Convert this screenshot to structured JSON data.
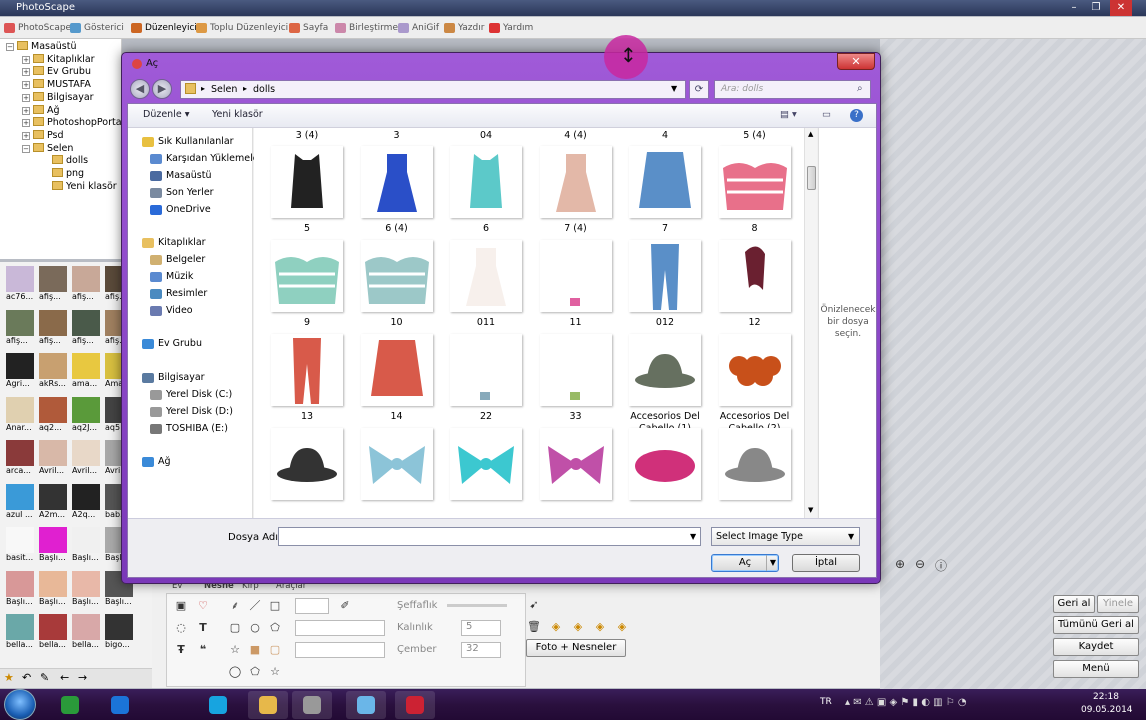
{
  "app": {
    "title": "PhotoScape",
    "tabs": [
      {
        "label": "PhotoScape",
        "color": "#d55"
      },
      {
        "label": "Gösterici",
        "color": "#59c"
      },
      {
        "label": "Düzenleyici",
        "color": "#c62"
      },
      {
        "label": "Toplu Düzenleyici",
        "color": "#d94"
      },
      {
        "label": "Sayfa",
        "color": "#d64"
      },
      {
        "label": "Birleştirme",
        "color": "#c8a"
      },
      {
        "label": "AniGif",
        "color": "#a9c"
      },
      {
        "label": "Yazdır",
        "color": "#c84"
      },
      {
        "label": "Yardım",
        "color": "#d33"
      }
    ],
    "window_controls": [
      "–",
      "❐",
      "✕"
    ],
    "folder_tree": [
      {
        "label": "Masaüstü",
        "level": 0,
        "expander": "−"
      },
      {
        "label": "Kitaplıklar",
        "level": 1,
        "expander": "+"
      },
      {
        "label": "Ev Grubu",
        "level": 1,
        "expander": "+"
      },
      {
        "label": "MUSTAFA",
        "level": 1,
        "expander": "+"
      },
      {
        "label": "Bilgisayar",
        "level": 1,
        "expander": "+"
      },
      {
        "label": "Ağ",
        "level": 1,
        "expander": "+"
      },
      {
        "label": "PhotoshopPorta",
        "level": 1,
        "expander": "+"
      },
      {
        "label": "Psd",
        "level": 1,
        "expander": "+"
      },
      {
        "label": "Selen",
        "level": 1,
        "expander": "−"
      },
      {
        "label": "dolls",
        "level": 2,
        "expander": ""
      },
      {
        "label": "png",
        "level": 2,
        "expander": ""
      },
      {
        "label": "Yeni klasör",
        "level": 2,
        "expander": ""
      }
    ],
    "thumbnails": [
      "ac76...",
      "afiş...",
      "afiş...",
      "afiş...",
      "afiş...",
      "afiş...",
      "afiş...",
      "afiş...",
      "Agri...",
      "akRs...",
      "ama...",
      "Ama...",
      "Anar...",
      "aq2...",
      "aq2J...",
      "aq5...",
      "arca...",
      "Avril...",
      "Avril...",
      "Avril...",
      "azul ...",
      "A2m...",
      "A2q...",
      "bab...",
      "basit...",
      "Başlı...",
      "Başlı...",
      "Başlı...",
      "Başlı...",
      "Başlı...",
      "Başlı...",
      "Başlı...",
      "bella...",
      "bella...",
      "bella...",
      "bigo..."
    ],
    "editor_tabs": [
      "Ev",
      "Nesne",
      "Kırp",
      "Araçlar"
    ],
    "editor_labels": {
      "transparency": "Şeffaflık",
      "thickness": "Kalınlık",
      "border": "Çember",
      "thickness_value": "5",
      "border_value": "32"
    },
    "photo_objects_button": "Foto + Nesneler",
    "right_buttons": {
      "undo": "Geri al",
      "redo": "Yinele",
      "undo_all": "Tümünü Geri al",
      "save": "Kaydet",
      "menu": "Menü"
    }
  },
  "dialog": {
    "title": "Aç",
    "close": "✕",
    "breadcrumb": [
      "Selen",
      "dolls"
    ],
    "search_placeholder": "Ara: dolls",
    "cmd_organize": "Düzenle",
    "cmd_new_folder": "Yeni klasör",
    "nav": {
      "favorites_header": "Sık Kullanılanlar",
      "favorites": [
        "Karşıdan Yüklemeler",
        "Masaüstü",
        "Son Yerler",
        "OneDrive"
      ],
      "libraries_header": "Kitaplıklar",
      "libraries": [
        "Belgeler",
        "Müzik",
        "Resimler",
        "Video"
      ],
      "homegroup": "Ev Grubu",
      "computer_header": "Bilgisayar",
      "drives": [
        "Yerel Disk (C:)",
        "Yerel Disk (D:)",
        "TOSHIBA (E:)"
      ],
      "network": "Ağ"
    },
    "top_labels": [
      "3 (4)",
      "3",
      "04",
      "4 (4)",
      "4",
      "5 (4)"
    ],
    "files": [
      {
        "name": "5",
        "color": "#222",
        "shape": "vest"
      },
      {
        "name": "6 (4)",
        "color": "#2a4fc8",
        "shape": "dress"
      },
      {
        "name": "6",
        "color": "#5cc9c9",
        "shape": "vest"
      },
      {
        "name": "7 (4)",
        "color": "#e3b8a8",
        "shape": "dress"
      },
      {
        "name": "7",
        "color": "#5a8fc8",
        "shape": "skirt"
      },
      {
        "name": "8",
        "color": "#e8708a",
        "shape": "top"
      },
      {
        "name": "9",
        "color": "#8fd0c0",
        "shape": "top"
      },
      {
        "name": "10",
        "color": "#9cc8c8",
        "shape": "top"
      },
      {
        "name": "011",
        "color": "#f7f0ec",
        "shape": "dress"
      },
      {
        "name": "11",
        "color": "#e060a0",
        "shape": "tiny"
      },
      {
        "name": "012",
        "color": "#5a8fc8",
        "shape": "pants"
      },
      {
        "name": "12",
        "color": "#6a2030",
        "shape": "hair"
      },
      {
        "name": "13",
        "color": "#d85a4a",
        "shape": "pants"
      },
      {
        "name": "14",
        "color": "#d85a4a",
        "shape": "skirt"
      },
      {
        "name": "22",
        "color": "#8ab",
        "shape": "tiny"
      },
      {
        "name": "33",
        "color": "#9b6",
        "shape": "tiny"
      },
      {
        "name": "Accesorios Del Cabello (1)",
        "color": "#667060",
        "shape": "hat"
      },
      {
        "name": "Accesorios Del Cabello (2)",
        "color": "#c8501a",
        "shape": "flower"
      },
      {
        "name": "",
        "color": "#333",
        "shape": "hat"
      },
      {
        "name": "",
        "color": "#8cc4d8",
        "shape": "bow"
      },
      {
        "name": "",
        "color": "#3cc8d0",
        "shape": "bow"
      },
      {
        "name": "",
        "color": "#c050a8",
        "shape": "bow"
      },
      {
        "name": "",
        "color": "#d0307a",
        "shape": "beret"
      },
      {
        "name": "",
        "color": "#888",
        "shape": "hat"
      }
    ],
    "preview_text": "Önizlenecek bir dosya seçin.",
    "filename_label": "Dosya Adı:",
    "filename_value": "",
    "type_select": "Select Image Type",
    "open_button": "Aç",
    "cancel_button": "İptal"
  },
  "taskbar": {
    "lang": "TR",
    "time": "22:18",
    "date": "09.05.2014",
    "apps": [
      {
        "name": "chrome",
        "color": "#2a9a3a"
      },
      {
        "name": "ie",
        "color": "#1b74d8"
      },
      {
        "name": "skype",
        "color": "#17a4e0"
      },
      {
        "name": "explorer",
        "color": "#e7b84a"
      },
      {
        "name": "photoscape",
        "color": "#999"
      },
      {
        "name": "notepad",
        "color": "#6ab6e8"
      },
      {
        "name": "photoscape-editor",
        "color": "#c23"
      }
    ]
  }
}
